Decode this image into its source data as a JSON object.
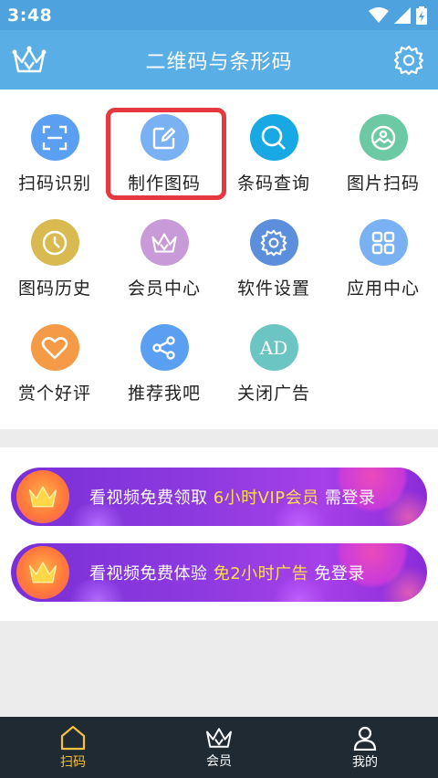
{
  "status": {
    "time": "3:48"
  },
  "header": {
    "title": "二维码与条形码",
    "left_icon": "crown-icon",
    "right_icon": "gear-icon"
  },
  "grid": [
    {
      "label": "扫码识别",
      "icon": "scan-frame-icon",
      "color": "#5b9ff3"
    },
    {
      "label": "制作图码",
      "icon": "edit-icon",
      "color": "#7ab1f3"
    },
    {
      "label": "条码查询",
      "icon": "search-icon",
      "color": "#18a9e4"
    },
    {
      "label": "图片扫码",
      "icon": "picture-icon",
      "color": "#6dc9a4"
    },
    {
      "label": "图码历史",
      "icon": "clock-icon",
      "color": "#d9ba51"
    },
    {
      "label": "会员中心",
      "icon": "crown-icon",
      "color": "#c89ad7"
    },
    {
      "label": "软件设置",
      "icon": "gear-icon",
      "color": "#5c8fdb"
    },
    {
      "label": "应用中心",
      "icon": "apps-icon",
      "color": "#7ab1f3"
    },
    {
      "label": "赏个好评",
      "icon": "heart-icon",
      "color": "#f59a46"
    },
    {
      "label": "推荐我吧",
      "icon": "share-icon",
      "color": "#5b9ff3"
    },
    {
      "label": "关闭广告",
      "icon": "ad-icon",
      "color": "#6bc6c3",
      "icon_text": "AD"
    }
  ],
  "banners": [
    {
      "text": "看视频免费领取 ",
      "highlight": "6小时VIP会员",
      "suffix": " 需登录"
    },
    {
      "text": "看视频免费体验 ",
      "highlight": "免2小时广告",
      "suffix": " 免登录"
    }
  ],
  "tabs": [
    {
      "label": "扫码",
      "icon": "home-icon",
      "active": true
    },
    {
      "label": "会员",
      "icon": "crown-icon",
      "active": false
    },
    {
      "label": "我的",
      "icon": "user-icon",
      "active": false
    }
  ],
  "colors": {
    "header": "#5aaee6",
    "accent": "#f6c142",
    "highlight_box": "#e8383f"
  }
}
